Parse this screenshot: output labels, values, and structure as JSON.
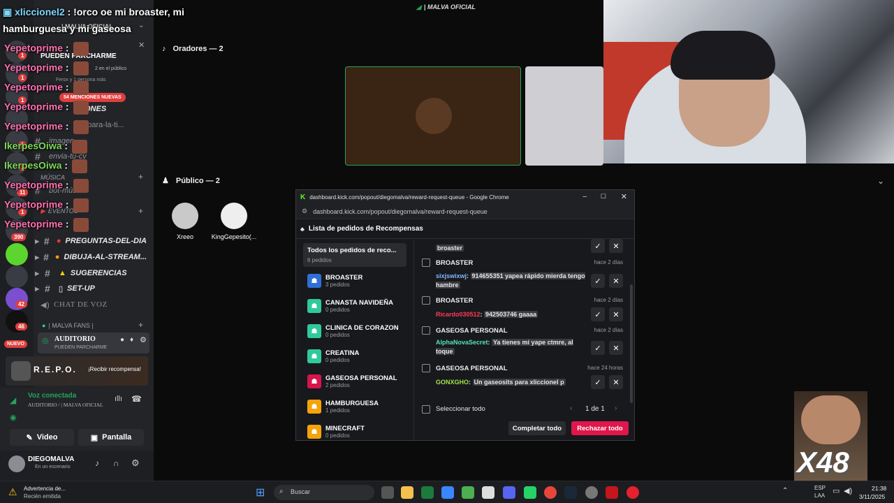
{
  "chat_overlay": {
    "top_line": {
      "user": "xliccionel2",
      "text": ": !orco oe mi broaster, mi"
    },
    "second_line": "hamburguesa y mi gaseosa",
    "lines": [
      {
        "user": "Yepetoprime",
        "sep": ":",
        "color": "pink"
      },
      {
        "user": "Yepetoprime",
        "sep": ":",
        "color": "pink"
      },
      {
        "user": "Yepetoprime",
        "sep": ":",
        "color": "pink"
      },
      {
        "user": "Yepetoprime",
        "sep": ":",
        "color": "pink"
      },
      {
        "user": "Yepetoprime",
        "sep": ":",
        "color": "pink"
      },
      {
        "user": "IkerpesOiwa",
        "sep": ":",
        "color": "green"
      },
      {
        "user": "IkerpesOiwa",
        "sep": ":",
        "color": "green"
      },
      {
        "user": "Yepetoprime",
        "sep": ":",
        "color": "pink"
      },
      {
        "user": "Yepetoprime",
        "sep": ":",
        "color": "pink"
      },
      {
        "user": "Yepetoprime",
        "sep": ":",
        "color": "pink"
      }
    ]
  },
  "server_rail": {
    "badges": [
      "1",
      "1",
      "1",
      "1",
      "1",
      "11",
      "1",
      "390",
      "42",
      "46"
    ],
    "new_label": "NUEVO"
  },
  "channels": {
    "server_header": "| MALVA OFICIAL",
    "event_card": {
      "title": "PUEDEN PARCHARME",
      "sub1": "2 en el público",
      "sub2": "Ferox y 1 persona más"
    },
    "mentions_pill": "54 MENCIONES NUEVAS",
    "items": [
      {
        "label": "CIONES",
        "kind": "text"
      },
      {
        "label": "ps-para-la-ti...",
        "kind": "text"
      },
      {
        "label": "imagen",
        "kind": "text"
      },
      {
        "label": "envia-tu-cv",
        "kind": "text"
      },
      {
        "label": "bot-música",
        "kind": "text"
      },
      {
        "label": "PREGUNTAS-DEL-DIA",
        "kind": "text"
      },
      {
        "label": "DIBUJA-AL-STREAM...",
        "kind": "text"
      },
      {
        "label": "SUGERENCIAS",
        "kind": "text"
      },
      {
        "label": "SET-UP",
        "kind": "text"
      },
      {
        "label": "CHAT DE VOZ",
        "kind": "voice"
      }
    ],
    "category_music": "MÚSICA",
    "category_events": "EVENTOS",
    "category_fans": "| MALVA FANS |",
    "stage": {
      "label": "AUDITORIO",
      "sub": "PUEDEN PARCHARME"
    }
  },
  "activity": {
    "game": "R.E.P.O.",
    "action": "¡Recibir recompensa!"
  },
  "voice": {
    "status": "Voz conectada",
    "location": "AUDITORIO / | MALVA OFICIAL",
    "video": "Video",
    "screen": "Pantalla"
  },
  "user": {
    "name": "DIEGOMALVA",
    "status": "En un escenario"
  },
  "top_center_title": "| MALVA OFICIAL",
  "stage_view": {
    "speakers_header": "Oradores — 2",
    "audience_header": "Público — 2",
    "audience": [
      "Xreeo",
      "KingGepesito(..."
    ]
  },
  "chrome": {
    "title": "dashboard.kick.com/popout/diegomalva/reward-request-queue - Google Chrome",
    "url": "dashboard.kick.com/popout/diegomalva/reward-request-queue",
    "page_title": "Lista de pedidos de Recompensas",
    "categories": [
      {
        "name": "Todos los pedidos de reco...",
        "count": "6 pedidos",
        "color": "#2b2c30"
      },
      {
        "name": "BROASTER",
        "count": "3 pedidos",
        "color": "#2f6fd6"
      },
      {
        "name": "CANASTA NAVIDEÑA",
        "count": "0 pedidos",
        "color": "#2fc99c"
      },
      {
        "name": "CLINICA DE CORAZON",
        "count": "0 pedidos",
        "color": "#2fc99c"
      },
      {
        "name": "CREATINA",
        "count": "0 pedidos",
        "color": "#2fc99c"
      },
      {
        "name": "GASEOSA PERSONAL",
        "count": "2 pedidos",
        "color": "#d4164a"
      },
      {
        "name": "HAMBURGUESA",
        "count": "1 pedidos",
        "color": "#f5a30a"
      },
      {
        "name": "MINECRAFT",
        "count": "0 pedidos",
        "color": "#f5a30a"
      }
    ],
    "requests": [
      {
        "title": "",
        "time": "",
        "user": "",
        "user_color": "#fff",
        "message": "broaster"
      },
      {
        "title": "BROASTER",
        "time": "hace 2 días",
        "user": "sixjswixwj",
        "user_color": "#7fb6ff",
        "message": "914655351 yapea rápido mierda tengo hambre"
      },
      {
        "title": "BROASTER",
        "time": "hace 2 días",
        "user": "Ricardo030512",
        "user_color": "#ff3b5c",
        "message": "942503746 gaaaa"
      },
      {
        "title": "GASEOSA PERSONAL",
        "time": "hace 2 días",
        "user": "AlphaNovaSecret",
        "user_color": "#53e6b0",
        "message": "Ya tienes mi yape ctmre, al toque"
      },
      {
        "title": "GASEOSA PERSONAL",
        "time": "hace 24 horas",
        "user": "GONXGHO",
        "user_color": "#a3e34a",
        "message": "Un gaseosits para xliccionel p"
      }
    ],
    "select_all": "Seleccionar todo",
    "pagination": "1 de 1",
    "complete_all": "Completar todo",
    "reject_all": "Rechazar todo"
  },
  "meme_overlay": "X48",
  "taskbar": {
    "notice_title": "Advertencia de...",
    "notice_sub": "Recién emitida",
    "search": "Buscar",
    "lang1": "ESP",
    "lang2": "LAA",
    "time": "21:38",
    "date": "3/11/2025"
  }
}
